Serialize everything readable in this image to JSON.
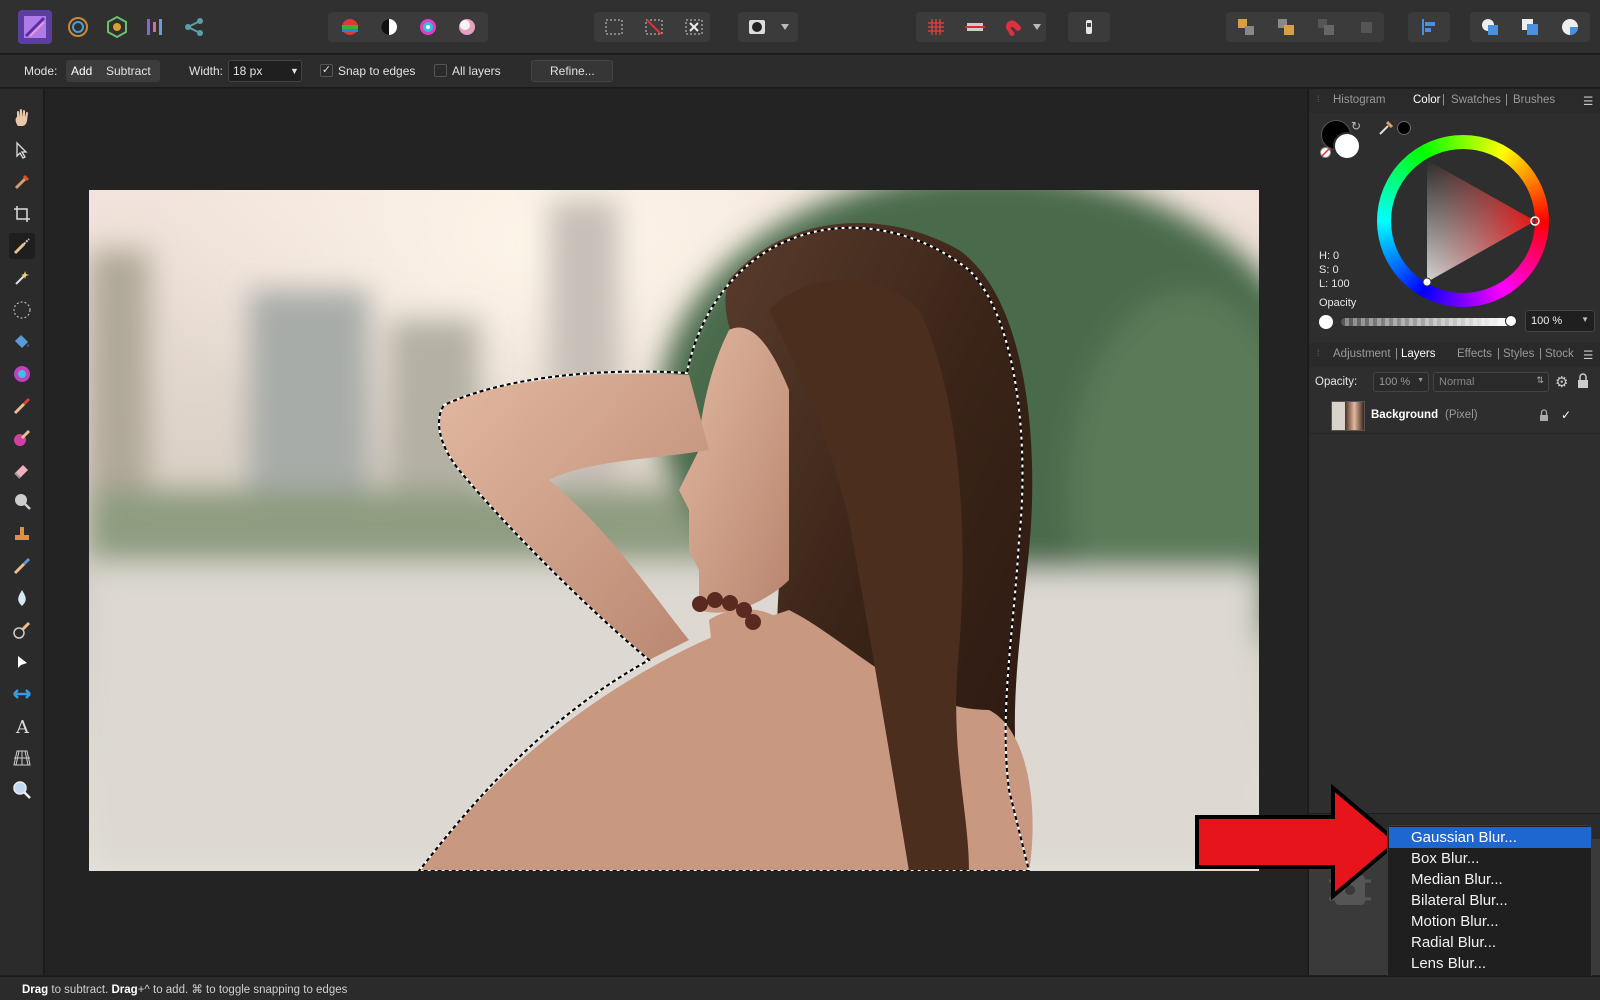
{
  "context_bar": {
    "mode_label": "Mode:",
    "mode_add": "Add",
    "mode_subtract": "Subtract",
    "width_label": "Width:",
    "width_value": "18 px",
    "snap_label": "Snap to edges",
    "snap_checked": true,
    "all_layers_label": "All layers",
    "all_layers_checked": false,
    "refine_label": "Refine..."
  },
  "color_panel": {
    "tabs": [
      "Histogram",
      "Color",
      "Swatches",
      "Brushes"
    ],
    "active_tab": "Color",
    "h_label": "H: 0",
    "s_label": "S: 0",
    "l_label": "L: 100",
    "opacity_label": "Opacity",
    "opacity_value": "100 %"
  },
  "layers_panel": {
    "tabs": [
      "Adjustment",
      "Layers",
      "Effects",
      "Styles",
      "Stock"
    ],
    "active_tab": "Layers",
    "opacity_label": "Opacity:",
    "opacity_value": "100 %",
    "blend_mode": "Normal",
    "layer_name": "Background",
    "layer_type": "(Pixel)"
  },
  "blur_menu": {
    "items": [
      "Gaussian Blur...",
      "Box Blur...",
      "Median Blur...",
      "Bilateral Blur...",
      "Motion Blur...",
      "Radial Blur...",
      "Lens Blur..."
    ],
    "selected": "Gaussian Blur..."
  },
  "status": {
    "drag1": "Drag",
    "text1": " to subtract. ",
    "drag2": "Drag",
    "text2": "+^ to add. ",
    "text3": "⌘ to toggle snapping to edges"
  },
  "colors": {
    "accent_blue": "#1e66d0",
    "arrow_red": "#e8141b"
  }
}
